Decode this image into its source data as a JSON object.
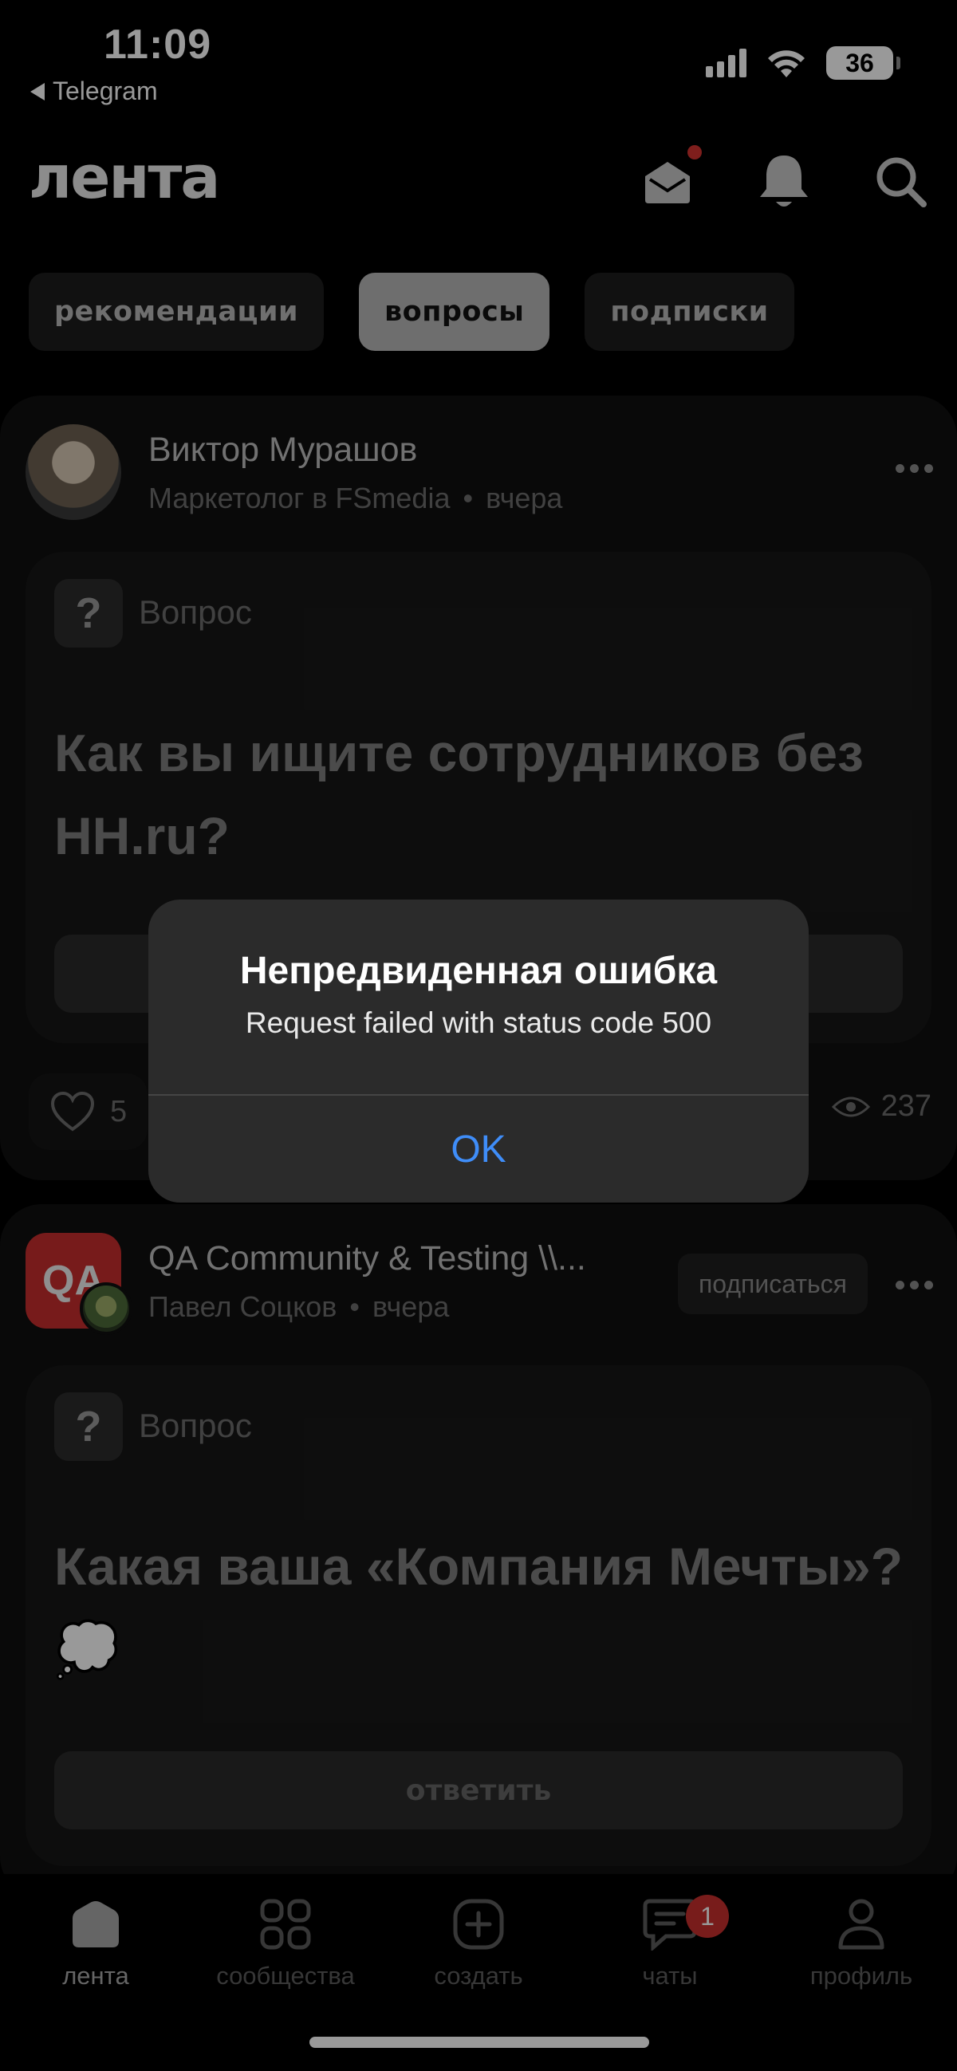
{
  "status_bar": {
    "time": "11:09",
    "back_label": "Telegram",
    "battery": "36"
  },
  "header": {
    "logo": "лента"
  },
  "tabs": [
    {
      "label": "рекомендации",
      "active": false
    },
    {
      "label": "вопросы",
      "active": true
    },
    {
      "label": "подписки",
      "active": false
    }
  ],
  "posts": [
    {
      "author": "Виктор Мурашов",
      "role": "Маркетолог в FSmedia",
      "time": "вчера",
      "type_label": "Вопрос",
      "title": "Как вы ищите сотрудников без HH.ru?",
      "likes": "5",
      "views": "237"
    },
    {
      "author": "QA Community  & Testing \\\\...",
      "avatar_text": "QA",
      "role": "Павел Соцков",
      "time": "вчера",
      "subscribe_label": "подписаться",
      "type_label": "Вопрос",
      "title": "Какая ваша «Компания Мечты»? 💭",
      "answer_label": "ответить"
    }
  ],
  "bottom_nav": [
    {
      "label": "лента",
      "icon": "home-icon",
      "active": true
    },
    {
      "label": "сообщества",
      "icon": "grid-icon",
      "active": false
    },
    {
      "label": "создать",
      "icon": "plus-square-icon",
      "active": false
    },
    {
      "label": "чаты",
      "icon": "chat-icon",
      "active": false,
      "badge": "1"
    },
    {
      "label": "профиль",
      "icon": "person-icon",
      "active": false
    }
  ],
  "alert": {
    "title": "Непредвиденная ошибка",
    "message": "Request failed with status code 500",
    "ok_label": "OK"
  },
  "colors": {
    "accent_blue": "#3f8df8",
    "badge_red": "#c8302d",
    "notification_dot": "#d2322f"
  }
}
